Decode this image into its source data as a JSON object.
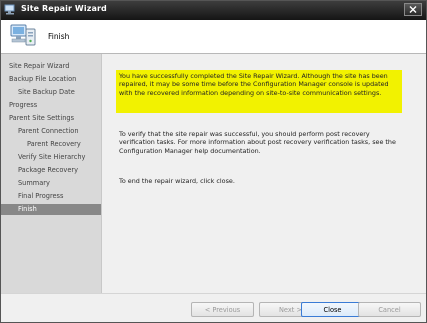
{
  "window": {
    "title": "Site Repair Wizard"
  },
  "header": {
    "title": "Finish"
  },
  "sidebar": {
    "items": [
      {
        "label": "Site Repair Wizard",
        "selected": false
      },
      {
        "label": "Backup File Location",
        "selected": false
      },
      {
        "label": "Site Backup Date",
        "selected": false
      },
      {
        "label": "Progress",
        "selected": false
      },
      {
        "label": "Parent Site Settings",
        "selected": false
      },
      {
        "label": "Parent Connection",
        "selected": false
      },
      {
        "label": "Parent Recovery",
        "selected": false
      },
      {
        "label": "Verify Site Hierarchy",
        "selected": false
      },
      {
        "label": "Package Recovery",
        "selected": false
      },
      {
        "label": "Summary",
        "selected": false
      },
      {
        "label": "Final Progress",
        "selected": false
      },
      {
        "label": "Finish",
        "selected": true
      }
    ]
  },
  "content": {
    "success_message": "You have successfully completed the Site Repair Wizard. Although the site has been repaired, it may be some time before the Configuration Manager console is updated with the recovered information depending on site-to-site communication settings.",
    "verify_message": "To verify that the site repair was successful, you should perform post recovery verification tasks. For more information about post recovery verification tasks, see the Configuration Manager help documentation.",
    "end_message": "To end the repair wizard, click close."
  },
  "buttons": {
    "previous": "< Previous",
    "next": "Next >",
    "close": "Close",
    "cancel": "Cancel"
  },
  "colors": {
    "highlight": "#f2f200",
    "selected_nav": "#888888",
    "titlebar": "#1f1f1f"
  }
}
